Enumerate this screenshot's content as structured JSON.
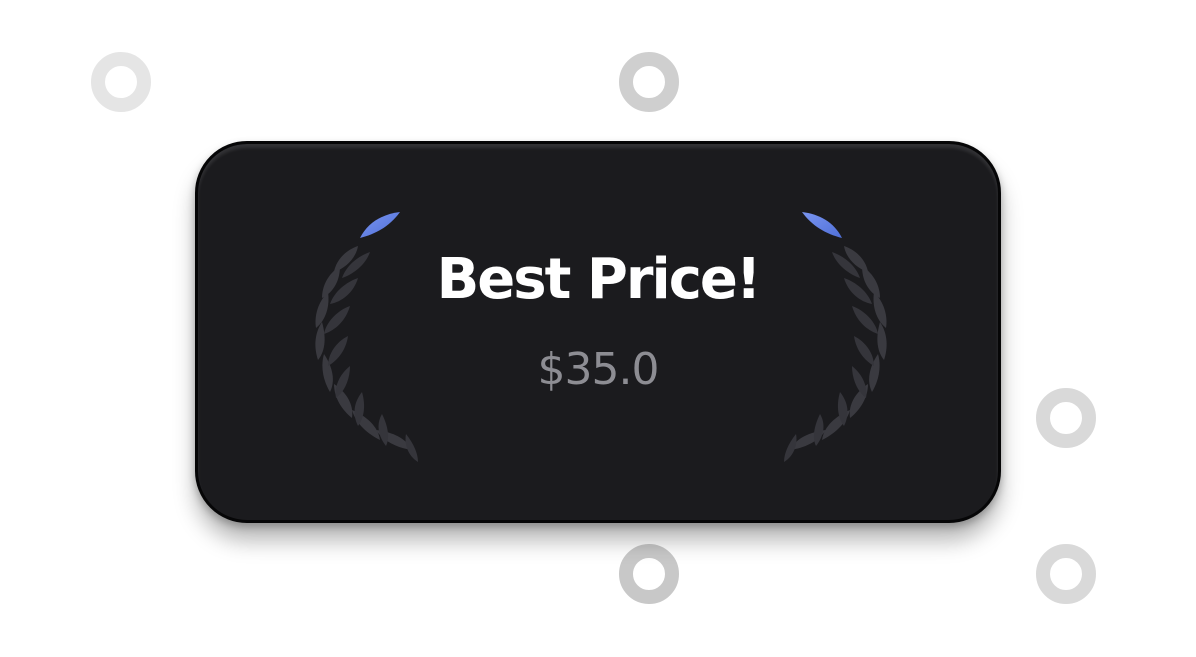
{
  "badge": {
    "title": "Best Price!",
    "price": "$35.0"
  },
  "icons": {
    "left_laurel": "laurel-branch-left-icon",
    "right_laurel": "laurel-branch-right-icon"
  },
  "colors": {
    "card_background": "#1b1b1e",
    "title_text": "#ffffff",
    "price_text": "#8d8d93",
    "laurel_leaf": "#3a3a40",
    "laurel_accent": "#5b7ce0",
    "selection_handle": "#d6d6d6"
  }
}
